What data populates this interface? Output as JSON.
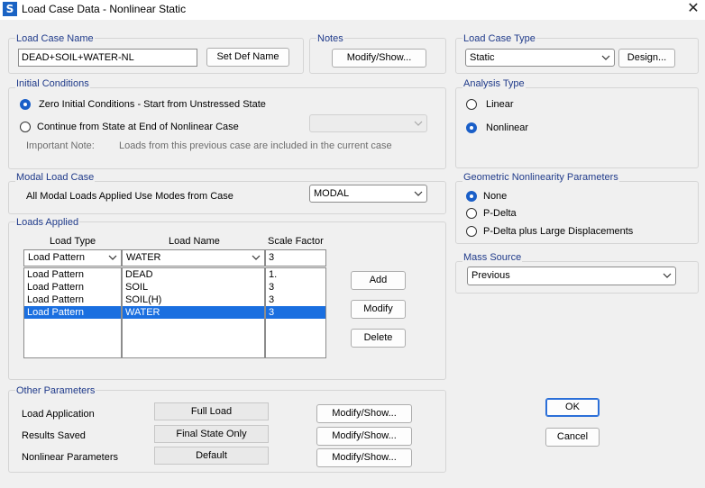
{
  "window": {
    "title": "Load Case Data - Nonlinear Static",
    "app_icon": "S",
    "close_glyph": "✕"
  },
  "load_case_name": {
    "title": "Load Case Name",
    "value": "DEAD+SOIL+WATER-NL",
    "set_def_name_button": "Set Def Name"
  },
  "notes": {
    "title": "Notes",
    "button": "Modify/Show..."
  },
  "load_case_type": {
    "title": "Load Case Type",
    "selected": "Static",
    "design_button": "Design..."
  },
  "initial_conditions": {
    "title": "Initial Conditions",
    "option_zero": "Zero Initial Conditions - Start from Unstressed State",
    "option_continue": "Continue from State at End of Nonlinear Case",
    "continue_case_value": "",
    "important_note_label": "Important Note:",
    "important_note_text": "Loads from this previous case are included in the current case",
    "selected": "zero"
  },
  "analysis_type": {
    "title": "Analysis Type",
    "option_linear": "Linear",
    "option_nonlinear": "Nonlinear",
    "selected": "nonlinear"
  },
  "modal_load_case": {
    "title": "Modal Load Case",
    "label": "All Modal Loads Applied Use Modes from Case",
    "selected": "MODAL"
  },
  "geometric_nonlinearity": {
    "title": "Geometric Nonlinearity Parameters",
    "option_none": "None",
    "option_pdelta": "P-Delta",
    "option_pdelta_large": "P-Delta plus Large Displacements",
    "selected": "none"
  },
  "loads_applied": {
    "title": "Loads Applied",
    "headers": {
      "load_type": "Load Type",
      "load_name": "Load Name",
      "scale_factor": "Scale Factor"
    },
    "editor": {
      "load_type": "Load Pattern",
      "load_name": "WATER",
      "scale_factor": "3"
    },
    "rows": [
      {
        "load_type": "Load Pattern",
        "load_name": "DEAD",
        "scale_factor": "1."
      },
      {
        "load_type": "Load Pattern",
        "load_name": "SOIL",
        "scale_factor": "3"
      },
      {
        "load_type": "Load Pattern",
        "load_name": "SOIL(H)",
        "scale_factor": "3"
      },
      {
        "load_type": "Load Pattern",
        "load_name": "WATER",
        "scale_factor": "3"
      }
    ],
    "selected_row": 3,
    "add_button": "Add",
    "modify_button": "Modify",
    "delete_button": "Delete"
  },
  "mass_source": {
    "title": "Mass Source",
    "selected": "Previous"
  },
  "other_parameters": {
    "title": "Other Parameters",
    "load_application": {
      "label": "Load Application",
      "value": "Full Load",
      "button": "Modify/Show..."
    },
    "results_saved": {
      "label": "Results Saved",
      "value": "Final State Only",
      "button": "Modify/Show..."
    },
    "nonlinear_parameters": {
      "label": "Nonlinear Parameters",
      "value": "Default",
      "button": "Modify/Show..."
    }
  },
  "dialog_buttons": {
    "ok": "OK",
    "cancel": "Cancel"
  }
}
